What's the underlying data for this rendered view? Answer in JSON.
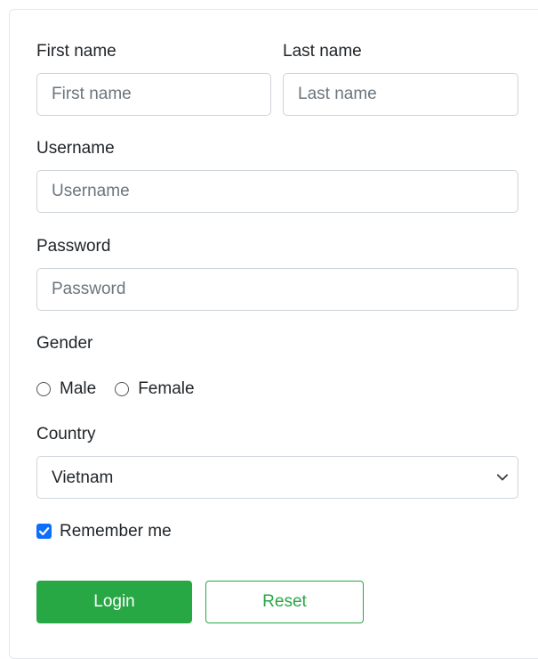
{
  "form": {
    "first_name": {
      "label": "First name",
      "placeholder": "First name",
      "value": ""
    },
    "last_name": {
      "label": "Last name",
      "placeholder": "Last name",
      "value": ""
    },
    "username": {
      "label": "Username",
      "placeholder": "Username",
      "value": ""
    },
    "password": {
      "label": "Password",
      "placeholder": "Password",
      "value": ""
    },
    "gender": {
      "label": "Gender",
      "options": [
        {
          "label": "Male",
          "checked": false
        },
        {
          "label": "Female",
          "checked": false
        }
      ]
    },
    "country": {
      "label": "Country",
      "value": "Vietnam"
    },
    "remember": {
      "label": "Remember me",
      "checked": true
    },
    "buttons": {
      "login": "Login",
      "reset": "Reset"
    }
  },
  "colors": {
    "primary_green": "#28a745",
    "checkbox_blue": "#0d6efd",
    "border": "#ced4da",
    "placeholder": "#6c757d"
  },
  "icons": {
    "select_indicator": "chevron-down-icon",
    "checkbox_mark": "checkmark-icon"
  }
}
